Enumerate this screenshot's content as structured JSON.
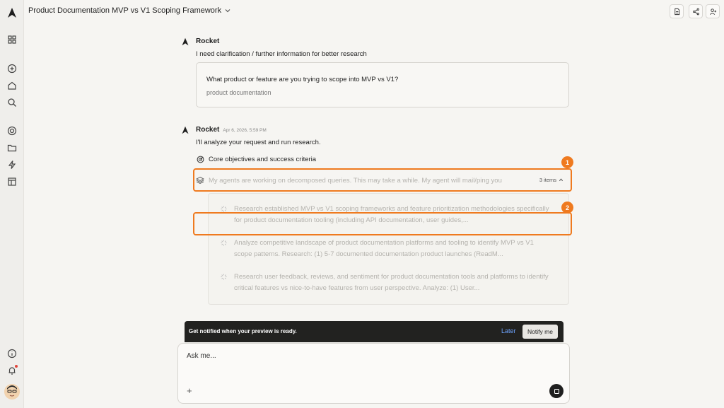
{
  "header": {
    "title": "Product Documentation MVP vs V1 Scoping Framework"
  },
  "messages": [
    {
      "sender": "Rocket",
      "timestamp": "",
      "text": "I need clarification / further information for better research",
      "question": "What product or feature are you trying to scope into MVP vs V1?",
      "answer": "product documentation"
    },
    {
      "sender": "Rocket",
      "timestamp": "Apr 6, 2026, 5:59 PM",
      "text": "I'll analyze your request and run research.",
      "objective": "Core objectives and success criteria",
      "agents_text": "My agents are working on decomposed queries. This may take a while. My agent will mail/ping you",
      "items_count": "3 items",
      "tasks": [
        "Research established MVP vs V1 scoping frameworks and feature prioritization methodologies specifically for product documentation tooling (including API documentation, user guides,...",
        "Analyze competitive landscape of product documentation platforms and tooling to identify MVP vs V1 scope patterns. Research: (1) 5-7 documented documentation product launches (ReadM...",
        "Research user feedback, reviews, and sentiment for product documentation tools and platforms to identify critical features vs nice-to-have features from user perspective. Analyze: (1) User..."
      ]
    }
  ],
  "annotations": [
    {
      "label": "1"
    },
    {
      "label": "2"
    }
  ],
  "notification": {
    "text": "Get notified when your preview is ready.",
    "later": "Later",
    "notify": "Notify me"
  },
  "input": {
    "placeholder": "Ask me...",
    "add_icon": "+"
  },
  "colors": {
    "highlight": "#ef7a1f",
    "link": "#6ea4ff",
    "background": "#f6f5f2"
  }
}
